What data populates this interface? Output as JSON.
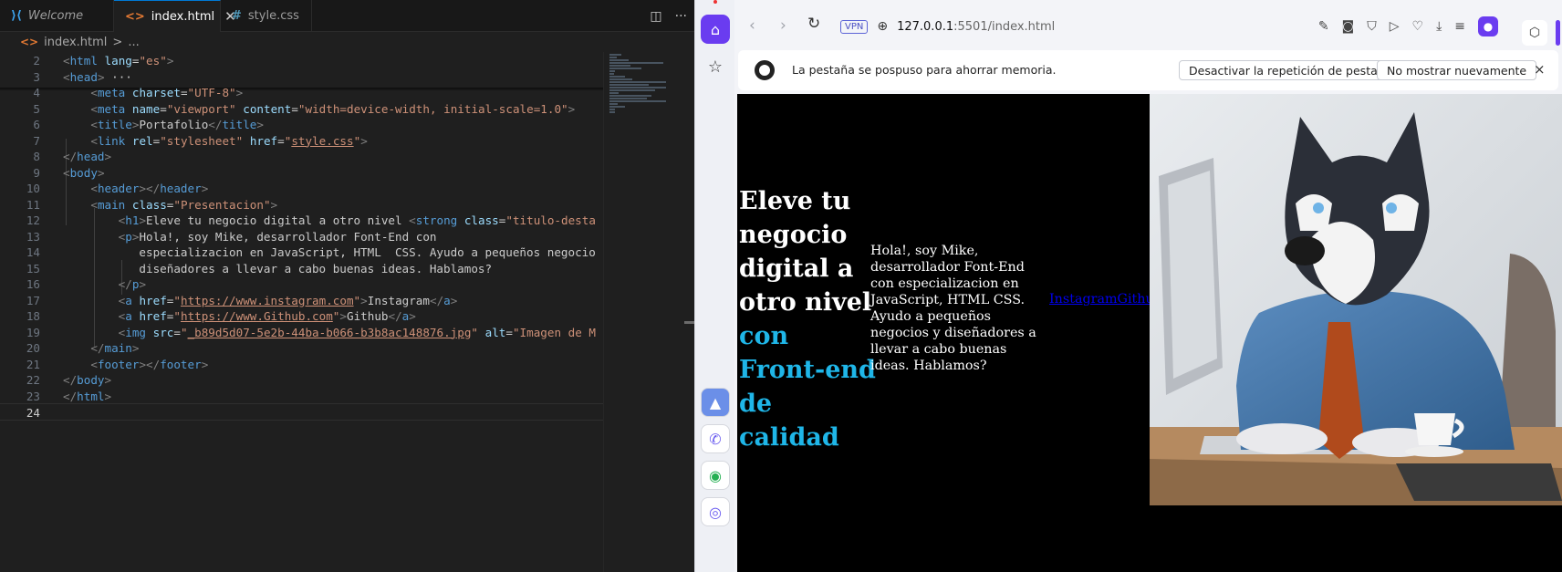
{
  "editor": {
    "tabs": [
      {
        "label": "Welcome",
        "icon": "vscode-icon"
      },
      {
        "label": "index.html",
        "icon": "html-icon",
        "active": true
      },
      {
        "label": "style.css",
        "icon": "css-icon"
      }
    ],
    "breadcrumb": [
      "index.html",
      ">",
      "..."
    ],
    "lines": [
      {
        "n": "2",
        "segs": [
          [
            "p",
            "<"
          ],
          [
            "t",
            "html"
          ],
          [
            "c",
            " "
          ],
          [
            "a",
            "lang"
          ],
          [
            "c",
            "="
          ],
          [
            "s",
            "\"es\""
          ],
          [
            "p",
            ">"
          ]
        ]
      },
      {
        "n": "3",
        "segs": [
          [
            "p",
            "<"
          ],
          [
            "t",
            "head"
          ],
          [
            "p",
            ">"
          ],
          [
            "c",
            " ···"
          ]
        ]
      },
      {
        "n": "4",
        "segs": [
          [
            "c",
            "    "
          ],
          [
            "p",
            "<"
          ],
          [
            "t",
            "meta"
          ],
          [
            "c",
            " "
          ],
          [
            "a",
            "charset"
          ],
          [
            "c",
            "="
          ],
          [
            "s",
            "\"UTF-8\""
          ],
          [
            "p",
            ">"
          ]
        ]
      },
      {
        "n": "5",
        "segs": [
          [
            "c",
            "    "
          ],
          [
            "p",
            "<"
          ],
          [
            "t",
            "meta"
          ],
          [
            "c",
            " "
          ],
          [
            "a",
            "name"
          ],
          [
            "c",
            "="
          ],
          [
            "s",
            "\"viewport\""
          ],
          [
            "c",
            " "
          ],
          [
            "a",
            "content"
          ],
          [
            "c",
            "="
          ],
          [
            "s",
            "\"width=device-width, initial-scale=1.0\""
          ],
          [
            "p",
            ">"
          ]
        ]
      },
      {
        "n": "6",
        "segs": [
          [
            "c",
            "    "
          ],
          [
            "p",
            "<"
          ],
          [
            "t",
            "title"
          ],
          [
            "p",
            ">"
          ],
          [
            "c",
            "Portafolio"
          ],
          [
            "p",
            "</"
          ],
          [
            "t",
            "title"
          ],
          [
            "p",
            ">"
          ]
        ]
      },
      {
        "n": "7",
        "segs": [
          [
            "c",
            "    "
          ],
          [
            "p",
            "<"
          ],
          [
            "t",
            "link"
          ],
          [
            "c",
            " "
          ],
          [
            "a",
            "rel"
          ],
          [
            "c",
            "="
          ],
          [
            "s",
            "\"stylesheet\""
          ],
          [
            "c",
            " "
          ],
          [
            "a",
            "href"
          ],
          [
            "c",
            "="
          ],
          [
            "s",
            "\""
          ],
          [
            "su",
            "style.css"
          ],
          [
            "s",
            "\""
          ],
          [
            "p",
            ">"
          ]
        ]
      },
      {
        "n": "8",
        "segs": [
          [
            "p",
            "</"
          ],
          [
            "t",
            "head"
          ],
          [
            "p",
            ">"
          ]
        ]
      },
      {
        "n": "9",
        "segs": [
          [
            "p",
            "<"
          ],
          [
            "t",
            "body"
          ],
          [
            "p",
            ">"
          ]
        ]
      },
      {
        "n": "10",
        "segs": [
          [
            "c",
            "    "
          ],
          [
            "p",
            "<"
          ],
          [
            "t",
            "header"
          ],
          [
            "p",
            "></"
          ],
          [
            "t",
            "header"
          ],
          [
            "p",
            ">"
          ]
        ]
      },
      {
        "n": "11",
        "segs": [
          [
            "c",
            "    "
          ],
          [
            "p",
            "<"
          ],
          [
            "t",
            "main"
          ],
          [
            "c",
            " "
          ],
          [
            "a",
            "class"
          ],
          [
            "c",
            "="
          ],
          [
            "s",
            "\"Presentacion\""
          ],
          [
            "p",
            ">"
          ]
        ]
      },
      {
        "n": "12",
        "segs": [
          [
            "c",
            "        "
          ],
          [
            "p",
            "<"
          ],
          [
            "t",
            "h1"
          ],
          [
            "p",
            ">"
          ],
          [
            "c",
            "Eleve tu negocio digital a otro nivel "
          ],
          [
            "p",
            "<"
          ],
          [
            "t",
            "strong"
          ],
          [
            "c",
            " "
          ],
          [
            "a",
            "class"
          ],
          [
            "c",
            "="
          ],
          [
            "s",
            "\"titulo-desta"
          ]
        ]
      },
      {
        "n": "13",
        "segs": [
          [
            "c",
            "        "
          ],
          [
            "p",
            "<"
          ],
          [
            "t",
            "p"
          ],
          [
            "p",
            ">"
          ],
          [
            "c",
            "Hola!, soy Mike, desarrollador Font-End con"
          ]
        ]
      },
      {
        "n": "14",
        "segs": [
          [
            "c",
            "           especializacion en JavaScript, HTML  CSS. Ayudo a pequeños negocio"
          ]
        ]
      },
      {
        "n": "15",
        "segs": [
          [
            "c",
            "           diseñadores a llevar a cabo buenas ideas. Hablamos?"
          ]
        ]
      },
      {
        "n": "16",
        "segs": [
          [
            "c",
            "        "
          ],
          [
            "p",
            "</"
          ],
          [
            "t",
            "p"
          ],
          [
            "p",
            ">"
          ]
        ]
      },
      {
        "n": "17",
        "segs": [
          [
            "c",
            "        "
          ],
          [
            "p",
            "<"
          ],
          [
            "t",
            "a"
          ],
          [
            "c",
            " "
          ],
          [
            "a",
            "href"
          ],
          [
            "c",
            "="
          ],
          [
            "s",
            "\""
          ],
          [
            "su",
            "https://www.instagram.com"
          ],
          [
            "s",
            "\""
          ],
          [
            "p",
            ">"
          ],
          [
            "c",
            "Instagram"
          ],
          [
            "p",
            "</"
          ],
          [
            "t",
            "a"
          ],
          [
            "p",
            ">"
          ]
        ]
      },
      {
        "n": "18",
        "segs": [
          [
            "c",
            "        "
          ],
          [
            "p",
            "<"
          ],
          [
            "t",
            "a"
          ],
          [
            "c",
            " "
          ],
          [
            "a",
            "href"
          ],
          [
            "c",
            "="
          ],
          [
            "s",
            "\""
          ],
          [
            "su",
            "https://www.Github.com"
          ],
          [
            "s",
            "\""
          ],
          [
            "p",
            ">"
          ],
          [
            "c",
            "Github"
          ],
          [
            "p",
            "</"
          ],
          [
            "t",
            "a"
          ],
          [
            "p",
            ">"
          ]
        ]
      },
      {
        "n": "19",
        "segs": [
          [
            "c",
            "        "
          ],
          [
            "p",
            "<"
          ],
          [
            "t",
            "img"
          ],
          [
            "c",
            " "
          ],
          [
            "a",
            "src"
          ],
          [
            "c",
            "="
          ],
          [
            "s",
            "\""
          ],
          [
            "su",
            "_b89d5d07-5e2b-44ba-b066-b3b8ac148876.jpg"
          ],
          [
            "s",
            "\""
          ],
          [
            "c",
            " "
          ],
          [
            "a",
            "alt"
          ],
          [
            "c",
            "="
          ],
          [
            "s",
            "\"Imagen de M"
          ]
        ]
      },
      {
        "n": "20",
        "segs": [
          [
            "c",
            "    "
          ],
          [
            "p",
            "</"
          ],
          [
            "t",
            "main"
          ],
          [
            "p",
            ">"
          ]
        ]
      },
      {
        "n": "21",
        "segs": [
          [
            "c",
            "    "
          ],
          [
            "p",
            "<"
          ],
          [
            "t",
            "footer"
          ],
          [
            "p",
            "></"
          ],
          [
            "t",
            "footer"
          ],
          [
            "p",
            ">"
          ]
        ]
      },
      {
        "n": "22",
        "segs": [
          [
            "p",
            "</"
          ],
          [
            "t",
            "body"
          ],
          [
            "p",
            ">"
          ]
        ]
      },
      {
        "n": "23",
        "segs": [
          [
            "p",
            "</"
          ],
          [
            "t",
            "html"
          ],
          [
            "p",
            ">"
          ]
        ]
      },
      {
        "n": "24",
        "segs": [],
        "current": true
      }
    ]
  },
  "browser": {
    "vpn_label": "VPN",
    "url_host": "127.0.0.1",
    "url_rest": ":5501/index.html",
    "notice": {
      "message": "La pestaña se pospuso para ahorrar memoria.",
      "disable_button": "Desactivar la repetición de pestañas",
      "dismiss_button": "No mostrar nuevamente",
      "close": "×"
    }
  },
  "page": {
    "h1_text": "Eleve tu negocio digital a otro nivel",
    "h1_strong": "con Front-end de calidad",
    "paragraph": "Hola!, soy Mike, desarrollador Font-End con especializacion en JavaScript, HTML CSS. Ayudo a pequeños negocios y diseñadores a llevar a cabo buenas ideas. Hablamos?",
    "link_instagram": "Instagram",
    "link_github": "Github",
    "image_alt": "Imagen de Mike"
  },
  "colors": {
    "accent_purple": "#6a3cf0",
    "strong_cyan": "#1fb6e8",
    "link_blue": "#0000ee",
    "editor_bg": "#1f1f1f"
  }
}
